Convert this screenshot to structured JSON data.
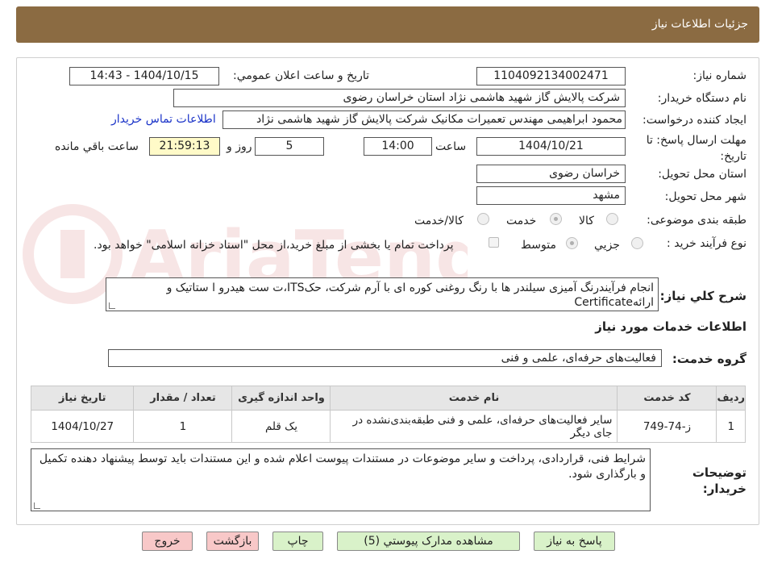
{
  "header": {
    "title": "جزئیات اطلاعات نیاز"
  },
  "fields": {
    "need_number_label": "شماره نیاز:",
    "need_number": "1104092134002471",
    "announce_label": "تاریخ و ساعت اعلان عمومي:",
    "announce_value": "1404/10/15 - 14:43",
    "buyer_org_label": "نام دستگاه خریدار:",
    "buyer_org": "شرکت پالایش گاز شهید هاشمی نژاد   استان خراسان رضوی",
    "requester_label": "ایجاد کننده درخواست:",
    "requester": "محمود ابراهیمی مهندس تعمیرات مکانیک شرکت پالایش گاز شهید هاشمی نژاد",
    "contact_link": "اطلاعات تماس خریدار",
    "deadline_label": "مهلت ارسال پاسخ: تا تاریخ:",
    "deadline_date": "1404/10/21",
    "hour_label": "ساعت",
    "deadline_time": "14:00",
    "days_value": "5",
    "days_label": "روز و",
    "remaining_time": "21:59:13",
    "remaining_label": "ساعت باقي مانده",
    "province_label": "استان محل تحویل:",
    "province": "خراسان رضوی",
    "city_label": "شهر محل تحویل:",
    "city": "مشهد",
    "category_label": "طبقه بندی موضوعی:",
    "category_options": [
      "کالا",
      "خدمت",
      "کالا/خدمت"
    ],
    "process_label": "نوع فرآیند خرید :",
    "process_options": [
      "جزيي",
      "متوسط"
    ],
    "payment_note": "پرداخت تمام یا بخشی از مبلغ خرید،از محل \"اسناد خزانه اسلامی\" خواهد بود.",
    "description_label": "شرح کلي نیاز:",
    "description": "انجام فرآیندرنگ آمیزی سیلندر ها با رنگ روغنی کوره ای با آرم شرکت، حکITS،ت ست هیدرو ا ستاتیک و ارائهCertificate"
  },
  "services": {
    "section_title": "اطلاعات خدمات مورد نیاز",
    "group_label": "گروه خدمت:",
    "group_value": "فعالیت‌های حرفه‌ای، علمی و فنی",
    "columns": [
      "ردیف",
      "کد خدمت",
      "نام خدمت",
      "واحد اندازه گیری",
      "تعداد / مقدار",
      "تاریخ نیاز"
    ],
    "rows": [
      {
        "row": "1",
        "code": "ز-74-749",
        "name": "سایر فعالیت‌های حرفه‌ای، علمی و فنی طبقه‌بندی‌نشده در جای دیگر",
        "unit": "یک قلم",
        "qty": "1",
        "date": "1404/10/27"
      }
    ]
  },
  "buyer_notes": {
    "label": "توضیحات خریدار:",
    "text": "شرایط فنی، قراردادی، پرداخت و سایر موضوعات در مستندات پیوست اعلام شده و این مستندات باید توسط پیشنهاد دهنده تکمیل و  بارگذاری شود."
  },
  "buttons": {
    "reply": "پاسخ به نیاز",
    "attachments": "مشاهده مدارک پیوستي (5)",
    "print": "چاپ",
    "back": "بازگشت",
    "exit": "خروج"
  },
  "colors": {
    "header_bg": "#8b6b42",
    "link": "#1a33c8",
    "green_btn": "#d9f2c9",
    "pink_btn": "#f8c8c8",
    "timer_bg": "#fffac8"
  }
}
